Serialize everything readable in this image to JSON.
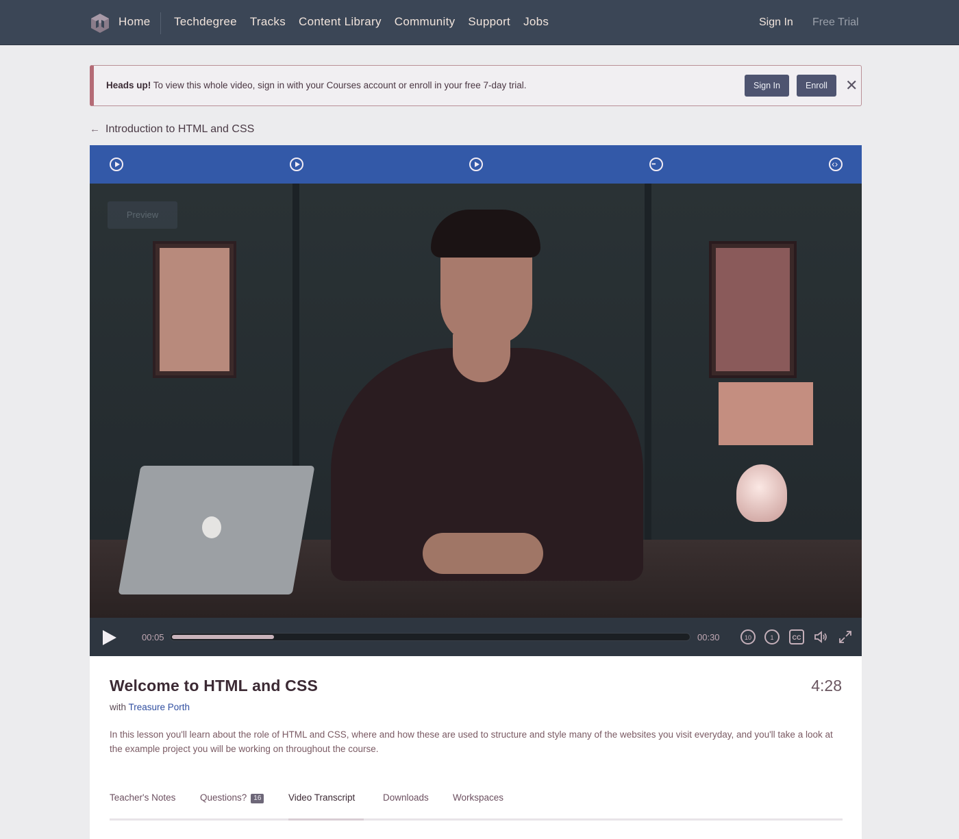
{
  "nav": {
    "home": "Home",
    "links": [
      "Techdegree",
      "Tracks",
      "Content Library",
      "Community",
      "Support",
      "Jobs"
    ],
    "sign_in": "Sign In",
    "free_trial": "Free Trial"
  },
  "alert": {
    "bold": "Heads up!",
    "text": " To view this whole video, sign in with your Courses account or enroll in your free 7-day trial.",
    "sign_in_label": "Sign In",
    "enroll_label": "Enroll",
    "close": "✕"
  },
  "breadcrumb": {
    "arrow": "←",
    "label": "Introduction to HTML and CSS"
  },
  "stages": [
    {
      "icon": "play-circle-icon"
    },
    {
      "icon": "play-circle-icon"
    },
    {
      "icon": "play-circle-icon"
    },
    {
      "icon": "quiz-dots-icon"
    },
    {
      "icon": "code-challenge-icon"
    }
  ],
  "video": {
    "preview_label": "Preview",
    "current_time": "00:05",
    "total_time": "00:30",
    "progress": 0.197,
    "rewind_label": "10",
    "speed_label": "1",
    "cc_label": "CC"
  },
  "lesson": {
    "title": "Welcome to HTML and CSS",
    "duration": "4:28",
    "with_prefix": "with ",
    "author": "Treasure Porth",
    "description": "In this lesson you'll learn about the role of HTML and CSS, where and how these are used to structure and style many of the websites you visit everyday, and you'll take a look at the example project you will be working on throughout the course."
  },
  "tabs": {
    "teachers_notes": "Teacher's Notes",
    "questions": "Questions?",
    "questions_count": "16",
    "transcript": "Video Transcript",
    "downloads": "Downloads",
    "workspaces": "Workspaces"
  },
  "colors": {
    "nav_bg": "#3b4656",
    "stage_bar": "#3359a8",
    "alert_accent": "#b46b76",
    "button_bg": "#4e5470",
    "author_link": "#2f4ea0"
  }
}
